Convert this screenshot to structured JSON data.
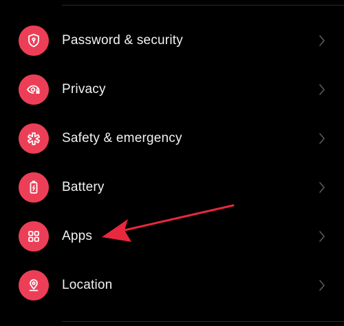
{
  "colors": {
    "background": "#000000",
    "icon_circle": "#ec3f57",
    "label_text": "#f2f2f2",
    "chevron": "#5a5a5a",
    "annotation_arrow": "#e8283e"
  },
  "settings": {
    "items": [
      {
        "label": "Password & security",
        "icon": "shield-lock-icon"
      },
      {
        "label": "Privacy",
        "icon": "privacy-eye-icon"
      },
      {
        "label": "Safety & emergency",
        "icon": "asterisk-icon"
      },
      {
        "label": "Battery",
        "icon": "battery-icon"
      },
      {
        "label": "Apps",
        "icon": "apps-grid-icon"
      },
      {
        "label": "Location",
        "icon": "location-pin-icon"
      }
    ]
  },
  "annotation": {
    "type": "arrow",
    "points_to": "Apps"
  }
}
